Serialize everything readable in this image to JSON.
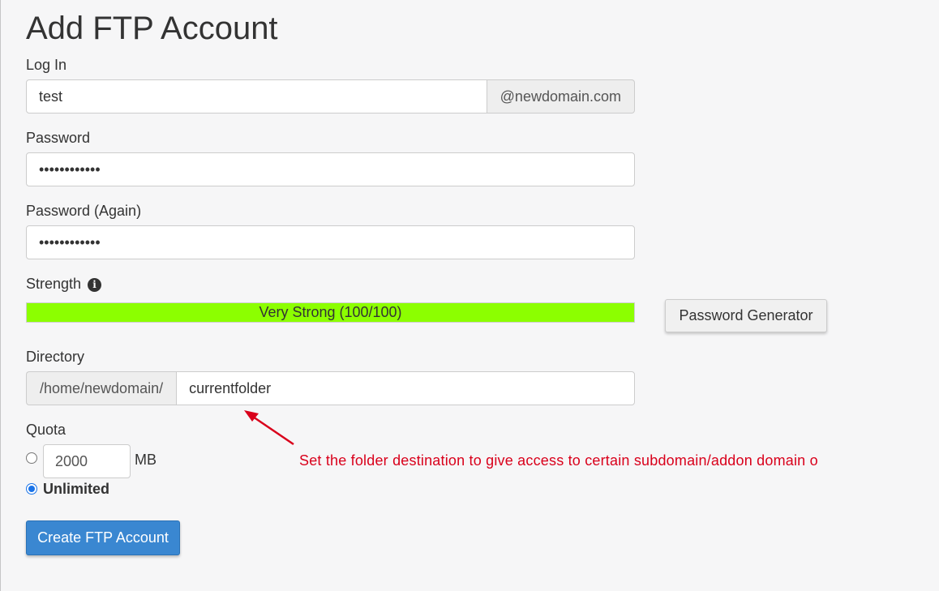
{
  "page": {
    "title": "Add FTP Account"
  },
  "login": {
    "label": "Log In",
    "value": "test",
    "domain_suffix": "@newdomain.com"
  },
  "password": {
    "label": "Password",
    "value": "••••••••••••"
  },
  "password_again": {
    "label": "Password (Again)",
    "value": "••••••••••••"
  },
  "strength": {
    "label": "Strength",
    "info_icon": "info-icon",
    "text": "Very Strong (100/100)",
    "percent": 100,
    "color": "#8cff00"
  },
  "password_generator": {
    "label": "Password Generator"
  },
  "directory": {
    "label": "Directory",
    "prefix": "/home/newdomain/",
    "value": "currentfolder"
  },
  "quota": {
    "label": "Quota",
    "value": "2000",
    "unit": "MB",
    "unlimited_label": "Unlimited",
    "selected": "unlimited"
  },
  "create_button": {
    "label": "Create FTP Account",
    "color": "#3a87d1"
  },
  "annotation": {
    "text": "Set the folder destination to give access to certain subdomain/addon domain o",
    "color": "#d9001b"
  }
}
